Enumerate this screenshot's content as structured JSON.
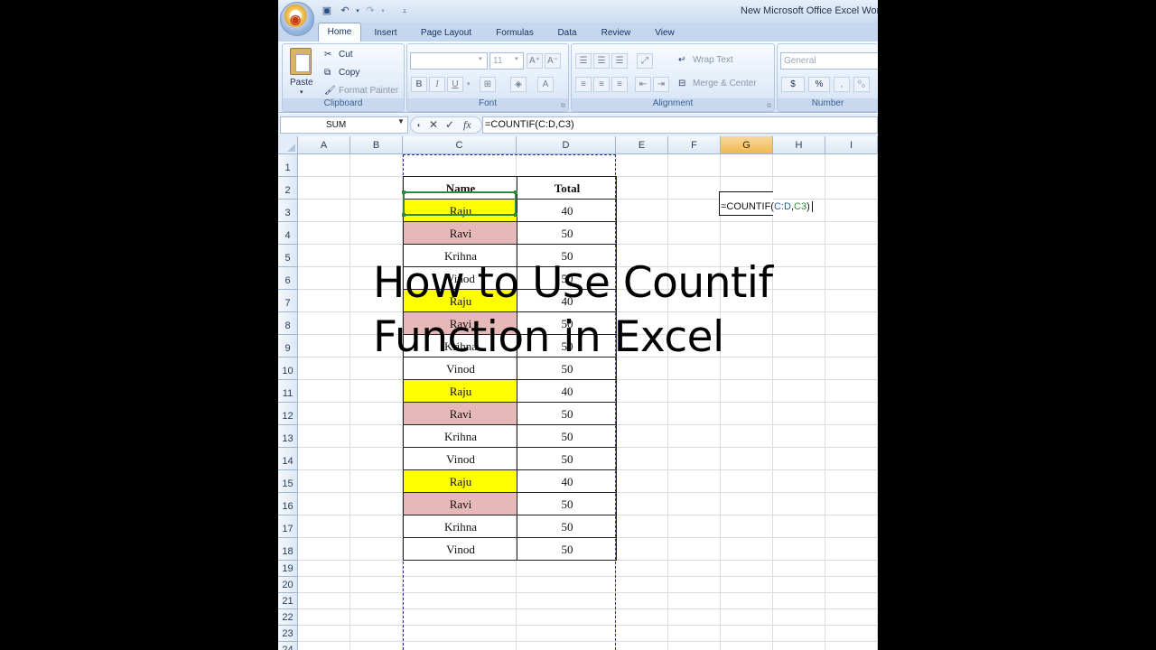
{
  "window": {
    "title": "New Microsoft Office Excel Wor",
    "office_button_label": "⊞"
  },
  "quick_access": [
    "save-icon",
    "undo-icon",
    "redo-icon",
    "customize-icon"
  ],
  "tabs": [
    {
      "label": "Home",
      "active": true
    },
    {
      "label": "Insert"
    },
    {
      "label": "Page Layout"
    },
    {
      "label": "Formulas"
    },
    {
      "label": "Data"
    },
    {
      "label": "Review"
    },
    {
      "label": "View"
    }
  ],
  "ribbon": {
    "clipboard": {
      "label": "Clipboard",
      "paste": "Paste",
      "cut": "Cut",
      "copy": "Copy",
      "format_painter": "Format Painter"
    },
    "font": {
      "label": "Font",
      "size": "11",
      "bold": "B",
      "italic": "I",
      "underline": "U"
    },
    "alignment": {
      "label": "Alignment",
      "wrap_text": "Wrap Text",
      "merge_center": "Merge & Center"
    },
    "number": {
      "label": "Number",
      "format": "General",
      "currency": "$",
      "percent": "%"
    }
  },
  "formula_bar": {
    "name_box": "SUM",
    "cancel": "✕",
    "enter": "✓",
    "fx": "fx",
    "formula": "=COUNTIF(C:D,C3)"
  },
  "columns": [
    "A",
    "B",
    "C",
    "D",
    "E",
    "F",
    "G",
    "H",
    "I"
  ],
  "selected_column": "G",
  "rows": [
    "1",
    "2",
    "3",
    "4",
    "5",
    "6",
    "7",
    "8",
    "9",
    "10",
    "11",
    "12",
    "13",
    "14",
    "15",
    "16",
    "17",
    "18",
    "19",
    "20",
    "21",
    "22",
    "23",
    "24"
  ],
  "table": {
    "header": {
      "name": "Name",
      "total": "Total"
    },
    "rows": [
      {
        "name": "Raju",
        "total": "40",
        "color": "yellow"
      },
      {
        "name": "Ravi",
        "total": "50",
        "color": "pink"
      },
      {
        "name": "Krihna",
        "total": "50",
        "color": "none"
      },
      {
        "name": "Vinod",
        "total": "50",
        "color": "none"
      },
      {
        "name": "Raju",
        "total": "40",
        "color": "yellow"
      },
      {
        "name": "Ravi",
        "total": "50",
        "color": "pink"
      },
      {
        "name": "Krihna",
        "total": "50",
        "color": "none"
      },
      {
        "name": "Vinod",
        "total": "50",
        "color": "none"
      },
      {
        "name": "Raju",
        "total": "40",
        "color": "yellow"
      },
      {
        "name": "Ravi",
        "total": "50",
        "color": "pink"
      },
      {
        "name": "Krihna",
        "total": "50",
        "color": "none"
      },
      {
        "name": "Vinod",
        "total": "50",
        "color": "none"
      },
      {
        "name": "Raju",
        "total": "40",
        "color": "yellow"
      },
      {
        "name": "Ravi",
        "total": "50",
        "color": "pink"
      },
      {
        "name": "Krihna",
        "total": "50",
        "color": "none"
      },
      {
        "name": "Vinod",
        "total": "50",
        "color": "none"
      }
    ]
  },
  "editing_cell": {
    "prefix": "=COUNTIF(",
    "ref1": "C:D",
    "sep": ",",
    "ref2": "C3",
    "suffix": ")"
  },
  "overlay": {
    "line1": "How to Use Countif",
    "line2": "Function in Excel"
  },
  "colors": {
    "yellow": "#ffff00",
    "pink": "#e6b8b7",
    "selection": "#2d8a3e"
  }
}
